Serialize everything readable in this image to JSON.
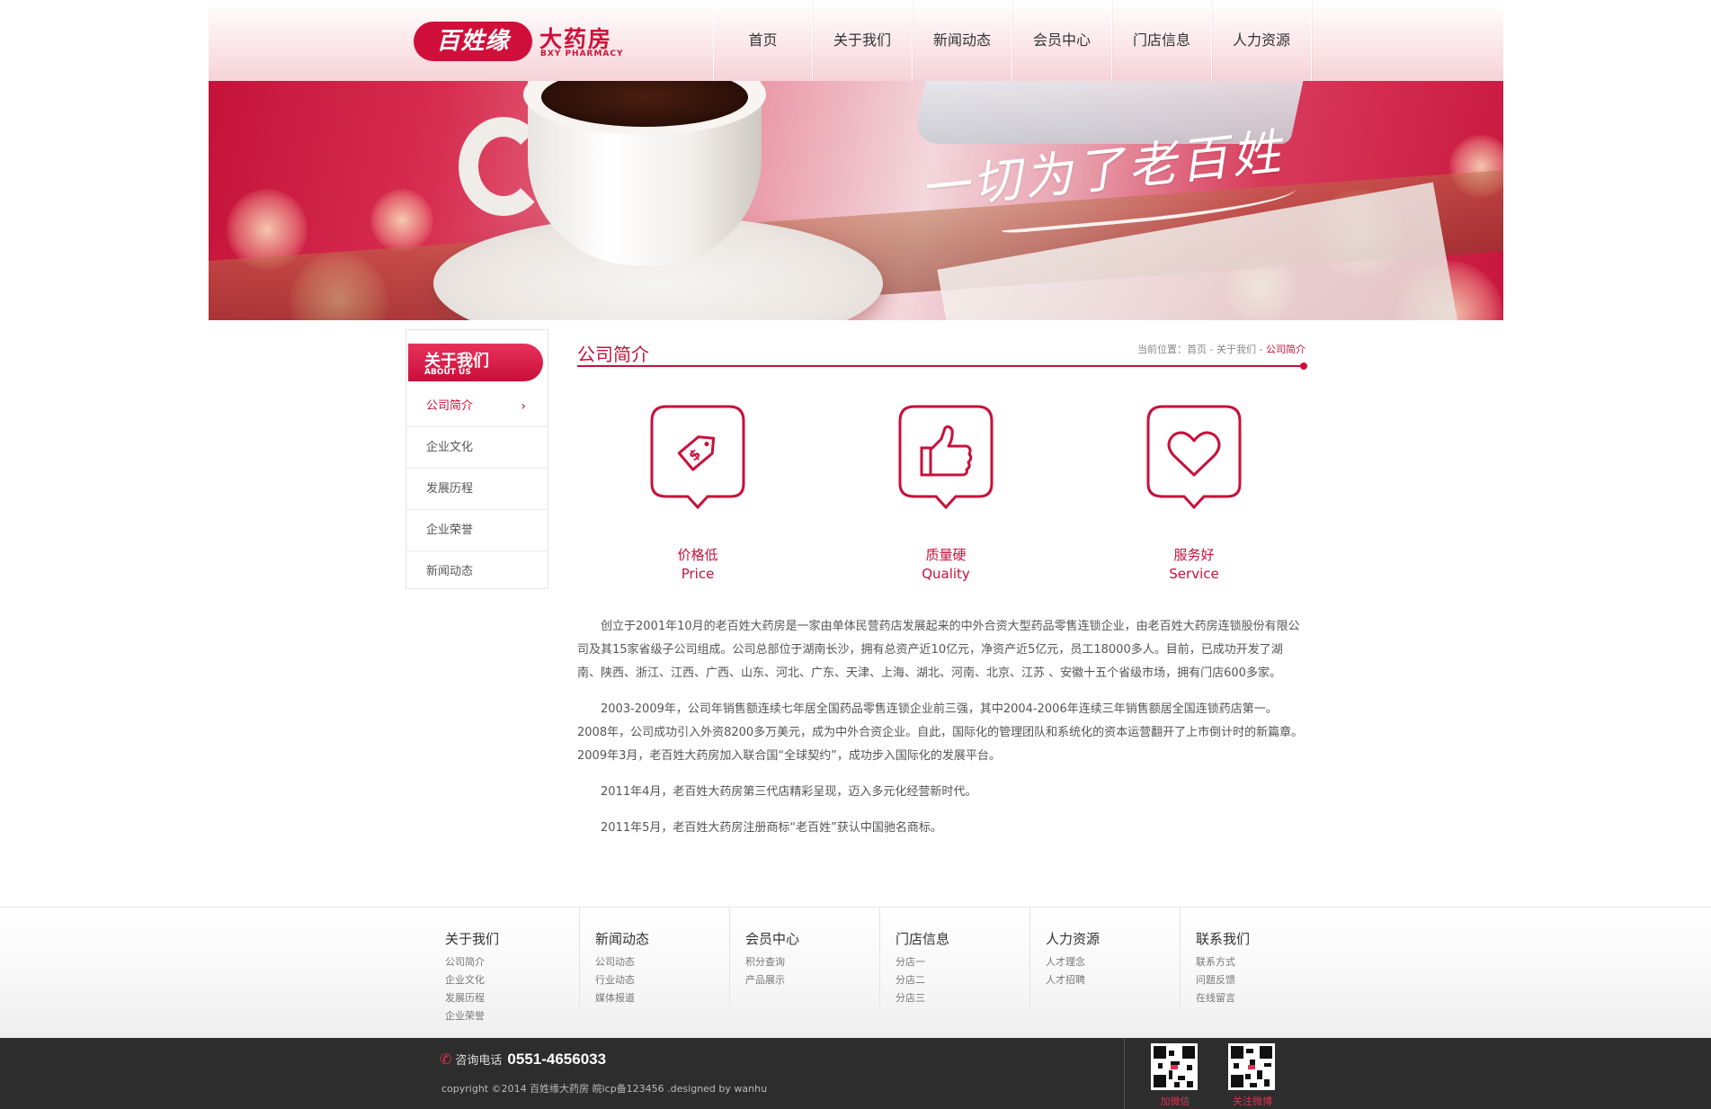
{
  "header": {
    "logo_badge": "百姓缘",
    "logo_cn": "大药房",
    "logo_en": "BXY PHARMACY",
    "nav": [
      "首页",
      "关于我们",
      "新闻动态",
      "会员中心",
      "门店信息",
      "人力资源"
    ]
  },
  "banner": {
    "slogan": "一切为了老百姓"
  },
  "sidebar": {
    "title_cn": "关于我们",
    "title_en": "ABOUT US",
    "items": [
      {
        "label": "公司简介",
        "active": true,
        "arrow": "›"
      },
      {
        "label": "企业文化"
      },
      {
        "label": "发展历程"
      },
      {
        "label": "企业荣誉"
      },
      {
        "label": "新闻动态"
      }
    ]
  },
  "main": {
    "title": "公司简介",
    "breadcrumb": {
      "prefix": "当前位置：",
      "home": "首页",
      "sep1": " - ",
      "parent": "关于我们",
      "sep2": " - ",
      "current": "公司简介"
    },
    "features": [
      {
        "icon": "price-tag-icon",
        "cn": "价格低",
        "en": "Price"
      },
      {
        "icon": "thumbs-up-icon",
        "cn": "质量硬",
        "en": "Quality"
      },
      {
        "icon": "heart-icon",
        "cn": "服务好",
        "en": "Service"
      }
    ],
    "paragraphs": [
      "创立于2001年10月的老百姓大药房是一家由单体民营药店发展起来的中外合资大型药品零售连锁企业，由老百姓大药房连锁股份有限公司及其15家省级子公司组成。公司总部位于湖南长沙，拥有总资产近10亿元，净资产近5亿元，员工18000多人。目前，已成功开发了湖南、陕西、浙江、江西、广西、山东、河北、广东、天津、上海、湖北、河南、北京、江苏 、安徽十五个省级市场，拥有门店600多家。",
      "2003-2009年，公司年销售额连续七年居全国药品零售连锁企业前三强，其中2004-2006年连续三年销售额居全国连锁药店第一。2008年，公司成功引入外资8200多万美元，成为中外合资企业。自此，国际化的管理团队和系统化的资本运营翻开了上市倒计时的新篇章。2009年3月，老百姓大药房加入联合国“全球契约”，成功步入国际化的发展平台。",
      "2011年4月，老百姓大药房第三代店精彩呈现，迈入多元化经营新时代。",
      "2011年5月，老百姓大药房注册商标“老百姓”获认中国驰名商标。"
    ]
  },
  "footer": {
    "columns": [
      {
        "title": "关于我们",
        "links": [
          "公司简介",
          "企业文化",
          "发展历程",
          "企业荣誉"
        ]
      },
      {
        "title": "新闻动态",
        "links": [
          "公司动态",
          "行业动态",
          "媒体报道"
        ]
      },
      {
        "title": "会员中心",
        "links": [
          "积分查询",
          "产品展示"
        ]
      },
      {
        "title": "门店信息",
        "links": [
          "分店一",
          "分店二",
          "分店三"
        ]
      },
      {
        "title": "人力资源",
        "links": [
          "人才理念",
          "人才招聘"
        ]
      },
      {
        "title": "联系我们",
        "links": [
          "联系方式",
          "问题反馈",
          "在线留言"
        ]
      }
    ],
    "phone_label": "咨询电话",
    "phone_number": "0551-4656033",
    "copyright": "copyright ©2014 百姓缘大药房 皖icp备123456 .designed by wanhu",
    "qr": [
      {
        "label": "加微信"
      },
      {
        "label": "关注微博"
      }
    ]
  },
  "colors": {
    "brand": "#c8103a",
    "footer_bg": "#2d2d2d"
  }
}
